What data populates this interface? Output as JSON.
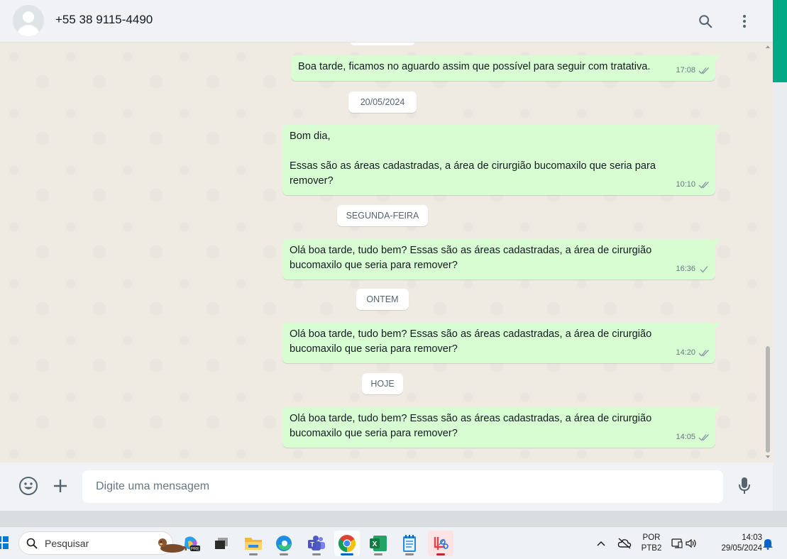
{
  "header": {
    "contact_name": "+55 38 9115-4490",
    "icons": [
      "avatar-placeholder",
      "search-icon",
      "kebab-menu-icon"
    ]
  },
  "messages": [
    {
      "text": "Boa tarde, ficamos no aguardo assim que possível para seguir com tratativa.",
      "time": "17:08",
      "status": "read"
    },
    {
      "text": "Bom dia,\n\nEssas são as áreas cadastradas, a área de cirurgião bucomaxilo que seria para\nremover?",
      "time": "10:10",
      "status": "read"
    },
    {
      "text": "Olá boa tarde, tudo bem? Essas são as áreas cadastradas, a área de cirurgião\nbucomaxilo que seria para remover?",
      "time": "16:36",
      "status": "delivered"
    },
    {
      "text": "Olá boa tarde, tudo bem? Essas são as áreas cadastradas, a área de cirurgião\nbucomaxilo que seria para remover?",
      "time": "14:20",
      "status": "read"
    },
    {
      "text": "Olá boa tarde, tudo bem? Essas são as áreas cadastradas, a área de cirurgião\nbucomaxilo que seria para remover?",
      "time": "14:05",
      "status": "read"
    }
  ],
  "date_separators": [
    "20/05/2024",
    "SEGUNDA-FEIRA",
    "ONTEM",
    "HOJE"
  ],
  "composer": {
    "placeholder": "Digite uma mensagem",
    "icons": [
      "emoji-icon",
      "plus-icon",
      "microphone-icon"
    ]
  },
  "taskbar": {
    "search_placeholder": "Pesquisar",
    "apps": [
      "copilot-pre-icon",
      "task-view-icon",
      "file-explorer-icon",
      "edge-icon",
      "teams-icon",
      "chrome-icon",
      "excel-icon",
      "notepad-icon",
      "snipping-tool-icon"
    ],
    "tray": {
      "lang_top": "POR",
      "lang_bottom": "PTB2",
      "time": "14:03",
      "date": "29/05/2024"
    }
  },
  "colors": {
    "outgoing_bubble": "#d9fdd3",
    "chat_background": "#efeae2",
    "header_background": "#f0f2f5",
    "read_tick": "#8696a0",
    "accent": "#00a884"
  }
}
